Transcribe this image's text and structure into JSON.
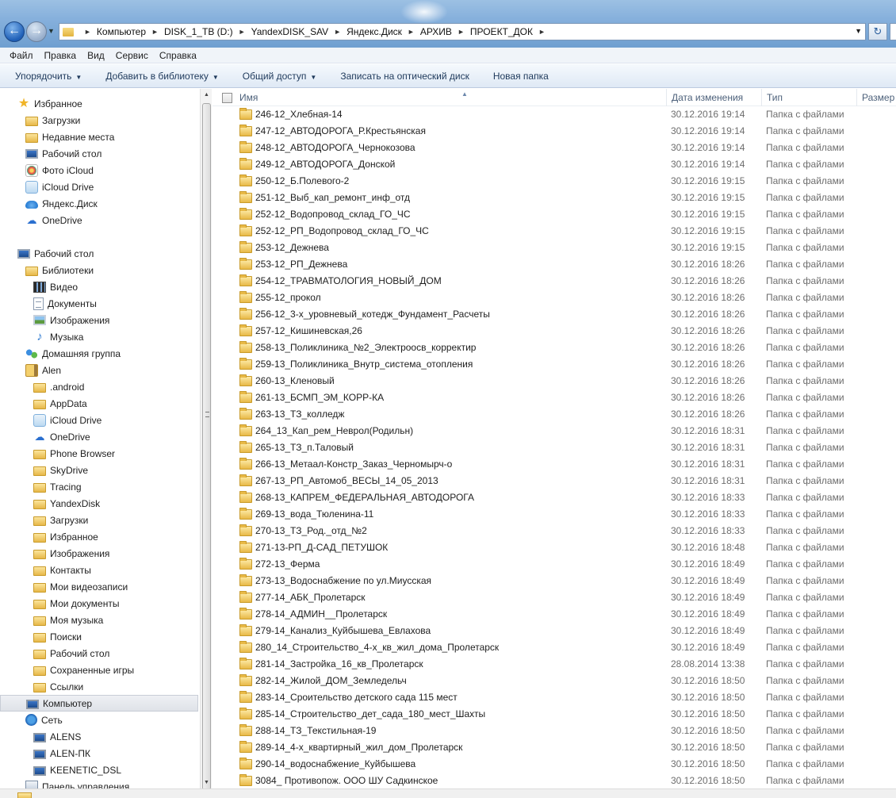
{
  "address": {
    "breadcrumbs": [
      "Компьютер",
      "DISK_1_TB (D:)",
      "YandexDISK_SAV",
      "Яндекс.Диск",
      "АРХИВ",
      "ПРОЕКТ_ДОК"
    ]
  },
  "menu": [
    "Файл",
    "Правка",
    "Вид",
    "Сервис",
    "Справка"
  ],
  "toolbar": {
    "organize": "Упорядочить",
    "add_library": "Добавить в библиотеку",
    "share": "Общий доступ",
    "burn": "Записать на оптический диск",
    "new_folder": "Новая папка"
  },
  "navpane": {
    "items": [
      {
        "label": "Избранное",
        "icon": "star-icon",
        "indent": 0
      },
      {
        "label": "Загрузки",
        "icon": "downloads-folder-icon",
        "indent": 1
      },
      {
        "label": "Недавние места",
        "icon": "recent-places-icon",
        "indent": 1
      },
      {
        "label": "Рабочий стол",
        "icon": "desktop-icon",
        "indent": 1
      },
      {
        "label": "Фото iCloud",
        "icon": "icloud-photos-icon",
        "indent": 1
      },
      {
        "label": "iCloud Drive",
        "icon": "icloud-drive-icon",
        "indent": 1
      },
      {
        "label": "Яндекс.Диск",
        "icon": "yandex-disk-icon",
        "indent": 1
      },
      {
        "label": "OneDrive",
        "icon": "onedrive-icon",
        "indent": 1
      },
      {
        "label": "",
        "icon": "",
        "indent": 0
      },
      {
        "label": "Рабочий стол",
        "icon": "desktop-icon",
        "indent": 0
      },
      {
        "label": "Библиотеки",
        "icon": "libraries-icon",
        "indent": 1
      },
      {
        "label": "Видео",
        "icon": "video-library-icon",
        "indent": 2
      },
      {
        "label": "Документы",
        "icon": "documents-library-icon",
        "indent": 2
      },
      {
        "label": "Изображения",
        "icon": "pictures-library-icon",
        "indent": 2
      },
      {
        "label": "Музыка",
        "icon": "music-library-icon",
        "indent": 2
      },
      {
        "label": "Домашняя группа",
        "icon": "homegroup-icon",
        "indent": 1
      },
      {
        "label": "Alen",
        "icon": "user-folder-icon",
        "indent": 1
      },
      {
        "label": ".android",
        "icon": "folder-icon",
        "indent": 2
      },
      {
        "label": "AppData",
        "icon": "folder-icon",
        "indent": 2
      },
      {
        "label": "iCloud Drive",
        "icon": "icloud-drive-icon",
        "indent": 2
      },
      {
        "label": "OneDrive",
        "icon": "onedrive-icon",
        "indent": 2
      },
      {
        "label": "Phone Browser",
        "icon": "folder-icon",
        "indent": 2
      },
      {
        "label": "SkyDrive",
        "icon": "folder-icon",
        "indent": 2
      },
      {
        "label": "Tracing",
        "icon": "folder-icon",
        "indent": 2
      },
      {
        "label": "YandexDisk",
        "icon": "folder-icon",
        "indent": 2
      },
      {
        "label": "Загрузки",
        "icon": "downloads-folder-icon",
        "indent": 2
      },
      {
        "label": "Избранное",
        "icon": "favorites-folder-icon",
        "indent": 2
      },
      {
        "label": "Изображения",
        "icon": "pictures-folder-icon",
        "indent": 2
      },
      {
        "label": "Контакты",
        "icon": "contacts-folder-icon",
        "indent": 2
      },
      {
        "label": "Мои видеозаписи",
        "icon": "videos-folder-icon",
        "indent": 2
      },
      {
        "label": "Мои документы",
        "icon": "documents-folder-icon",
        "indent": 2
      },
      {
        "label": "Моя музыка",
        "icon": "music-folder-icon",
        "indent": 2
      },
      {
        "label": "Поиски",
        "icon": "searches-folder-icon",
        "indent": 2
      },
      {
        "label": "Рабочий стол",
        "icon": "desktop-folder-icon",
        "indent": 2
      },
      {
        "label": "Сохраненные игры",
        "icon": "saved-games-folder-icon",
        "indent": 2
      },
      {
        "label": "Ссылки",
        "icon": "links-folder-icon",
        "indent": 2
      },
      {
        "label": "Компьютер",
        "icon": "computer-icon",
        "indent": 1,
        "selected": true
      },
      {
        "label": "Сеть",
        "icon": "network-icon",
        "indent": 1
      },
      {
        "label": "ALENS",
        "icon": "network-computer-icon",
        "indent": 2
      },
      {
        "label": "ALEN-ПК",
        "icon": "network-computer-icon",
        "indent": 2
      },
      {
        "label": "KEENETIC_DSL",
        "icon": "network-computer-icon",
        "indent": 2
      },
      {
        "label": "Панель управления",
        "icon": "control-panel-icon",
        "indent": 1
      }
    ]
  },
  "columns": {
    "name": "Имя",
    "date": "Дата изменения",
    "type": "Тип",
    "size": "Размер"
  },
  "files": [
    {
      "name": "246-12_Хлебная-14",
      "date": "30.12.2016 19:14",
      "type": "Папка с файлами"
    },
    {
      "name": "247-12_АВТОДОРОГА_Р.Крестьянская",
      "date": "30.12.2016 19:14",
      "type": "Папка с файлами"
    },
    {
      "name": "248-12_АВТОДОРОГА_Чернокозова",
      "date": "30.12.2016 19:14",
      "type": "Папка с файлами"
    },
    {
      "name": "249-12_АВТОДОРОГА_Донской",
      "date": "30.12.2016 19:14",
      "type": "Папка с файлами"
    },
    {
      "name": "250-12_Б.Полевого-2",
      "date": "30.12.2016 19:15",
      "type": "Папка с файлами"
    },
    {
      "name": "251-12_Выб_кап_ремонт_инф_отд",
      "date": "30.12.2016 19:15",
      "type": "Папка с файлами"
    },
    {
      "name": "252-12_Водопровод_склад_ГО_ЧС",
      "date": "30.12.2016 19:15",
      "type": "Папка с файлами"
    },
    {
      "name": "252-12_РП_Водопровод_склад_ГО_ЧС",
      "date": "30.12.2016 19:15",
      "type": "Папка с файлами"
    },
    {
      "name": "253-12_Дежнева",
      "date": "30.12.2016 19:15",
      "type": "Папка с файлами"
    },
    {
      "name": "253-12_РП_Дежнева",
      "date": "30.12.2016 18:26",
      "type": "Папка с файлами"
    },
    {
      "name": "254-12_ТРАВМАТОЛОГИЯ_НОВЫЙ_ДОМ",
      "date": "30.12.2016 18:26",
      "type": "Папка с файлами"
    },
    {
      "name": "255-12_прокол",
      "date": "30.12.2016 18:26",
      "type": "Папка с файлами"
    },
    {
      "name": "256-12_3-х_уровневый_котедж_Фундамент_Расчеты",
      "date": "30.12.2016 18:26",
      "type": "Папка с файлами"
    },
    {
      "name": "257-12_Кишиневская,26",
      "date": "30.12.2016 18:26",
      "type": "Папка с файлами"
    },
    {
      "name": "258-13_Поликлиника_№2_Электроосв_корректир",
      "date": "30.12.2016 18:26",
      "type": "Папка с файлами"
    },
    {
      "name": "259-13_Поликлиника_Внутр_система_отопления",
      "date": "30.12.2016 18:26",
      "type": "Папка с файлами"
    },
    {
      "name": "260-13_Кленовый",
      "date": "30.12.2016 18:26",
      "type": "Папка с файлами"
    },
    {
      "name": "261-13_БСМП_ЭМ_КОРР-КА",
      "date": "30.12.2016 18:26",
      "type": "Папка с файлами"
    },
    {
      "name": "263-13_ТЗ_колледж",
      "date": "30.12.2016 18:26",
      "type": "Папка с файлами"
    },
    {
      "name": "264_13_Кап_рем_Неврол(Родильн)",
      "date": "30.12.2016 18:31",
      "type": "Папка с файлами"
    },
    {
      "name": "265-13_ТЗ_п.Таловый",
      "date": "30.12.2016 18:31",
      "type": "Папка с файлами"
    },
    {
      "name": "266-13_Метаал-Констр_Заказ_Черномырч-о",
      "date": "30.12.2016 18:31",
      "type": "Папка с файлами"
    },
    {
      "name": "267-13_РП_Автомоб_ВЕСЫ_14_05_2013",
      "date": "30.12.2016 18:31",
      "type": "Папка с файлами"
    },
    {
      "name": "268-13_КАПРЕМ_ФЕДЕРАЛЬНАЯ_АВТОДОРОГА",
      "date": "30.12.2016 18:33",
      "type": "Папка с файлами"
    },
    {
      "name": "269-13_вода_Тюленина-11",
      "date": "30.12.2016 18:33",
      "type": "Папка с файлами"
    },
    {
      "name": "270-13_ТЗ_Род._отд_№2",
      "date": "30.12.2016 18:33",
      "type": "Папка с файлами"
    },
    {
      "name": "271-13-РП_Д-САД_ПЕТУШОК",
      "date": "30.12.2016 18:48",
      "type": "Папка с файлами"
    },
    {
      "name": "272-13_Ферма",
      "date": "30.12.2016 18:49",
      "type": "Папка с файлами"
    },
    {
      "name": "273-13_Водоснабжение по ул.Миусская",
      "date": "30.12.2016 18:49",
      "type": "Папка с файлами"
    },
    {
      "name": "277-14_АБК_Пролетарск",
      "date": "30.12.2016 18:49",
      "type": "Папка с файлами"
    },
    {
      "name": "278-14_АДМИН__Пролетарск",
      "date": "30.12.2016 18:49",
      "type": "Папка с файлами"
    },
    {
      "name": "279-14_Канализ_Куйбышева_Евлахова",
      "date": "30.12.2016 18:49",
      "type": "Папка с файлами"
    },
    {
      "name": "280_14_Строительство_4-х_кв_жил_дома_Пролетарск",
      "date": "30.12.2016 18:49",
      "type": "Папка с файлами"
    },
    {
      "name": "281-14_Застройка_16_кв_Пролетарск",
      "date": "28.08.2014 13:38",
      "type": "Папка с файлами"
    },
    {
      "name": "282-14_Жилой_ДОМ_Земледельч",
      "date": "30.12.2016 18:50",
      "type": "Папка с файлами"
    },
    {
      "name": "283-14_Сроительство детского сада 115 мест",
      "date": "30.12.2016 18:50",
      "type": "Папка с файлами"
    },
    {
      "name": "285-14_Строительство_дет_сада_180_мест_Шахты",
      "date": "30.12.2016 18:50",
      "type": "Папка с файлами"
    },
    {
      "name": "288-14_ТЗ_Текстильная-19",
      "date": "30.12.2016 18:50",
      "type": "Папка с файлами"
    },
    {
      "name": "289-14_4-х_квартирный_жил_дом_Пролетарск",
      "date": "30.12.2016 18:50",
      "type": "Папка с файлами"
    },
    {
      "name": "290-14_водоснабжение_Куйбышева",
      "date": "30.12.2016 18:50",
      "type": "Папка с файлами"
    },
    {
      "name": "3084_ Противопож. ООО  ШУ Садкинское",
      "date": "30.12.2016 18:50",
      "type": "Папка с файлами"
    }
  ]
}
